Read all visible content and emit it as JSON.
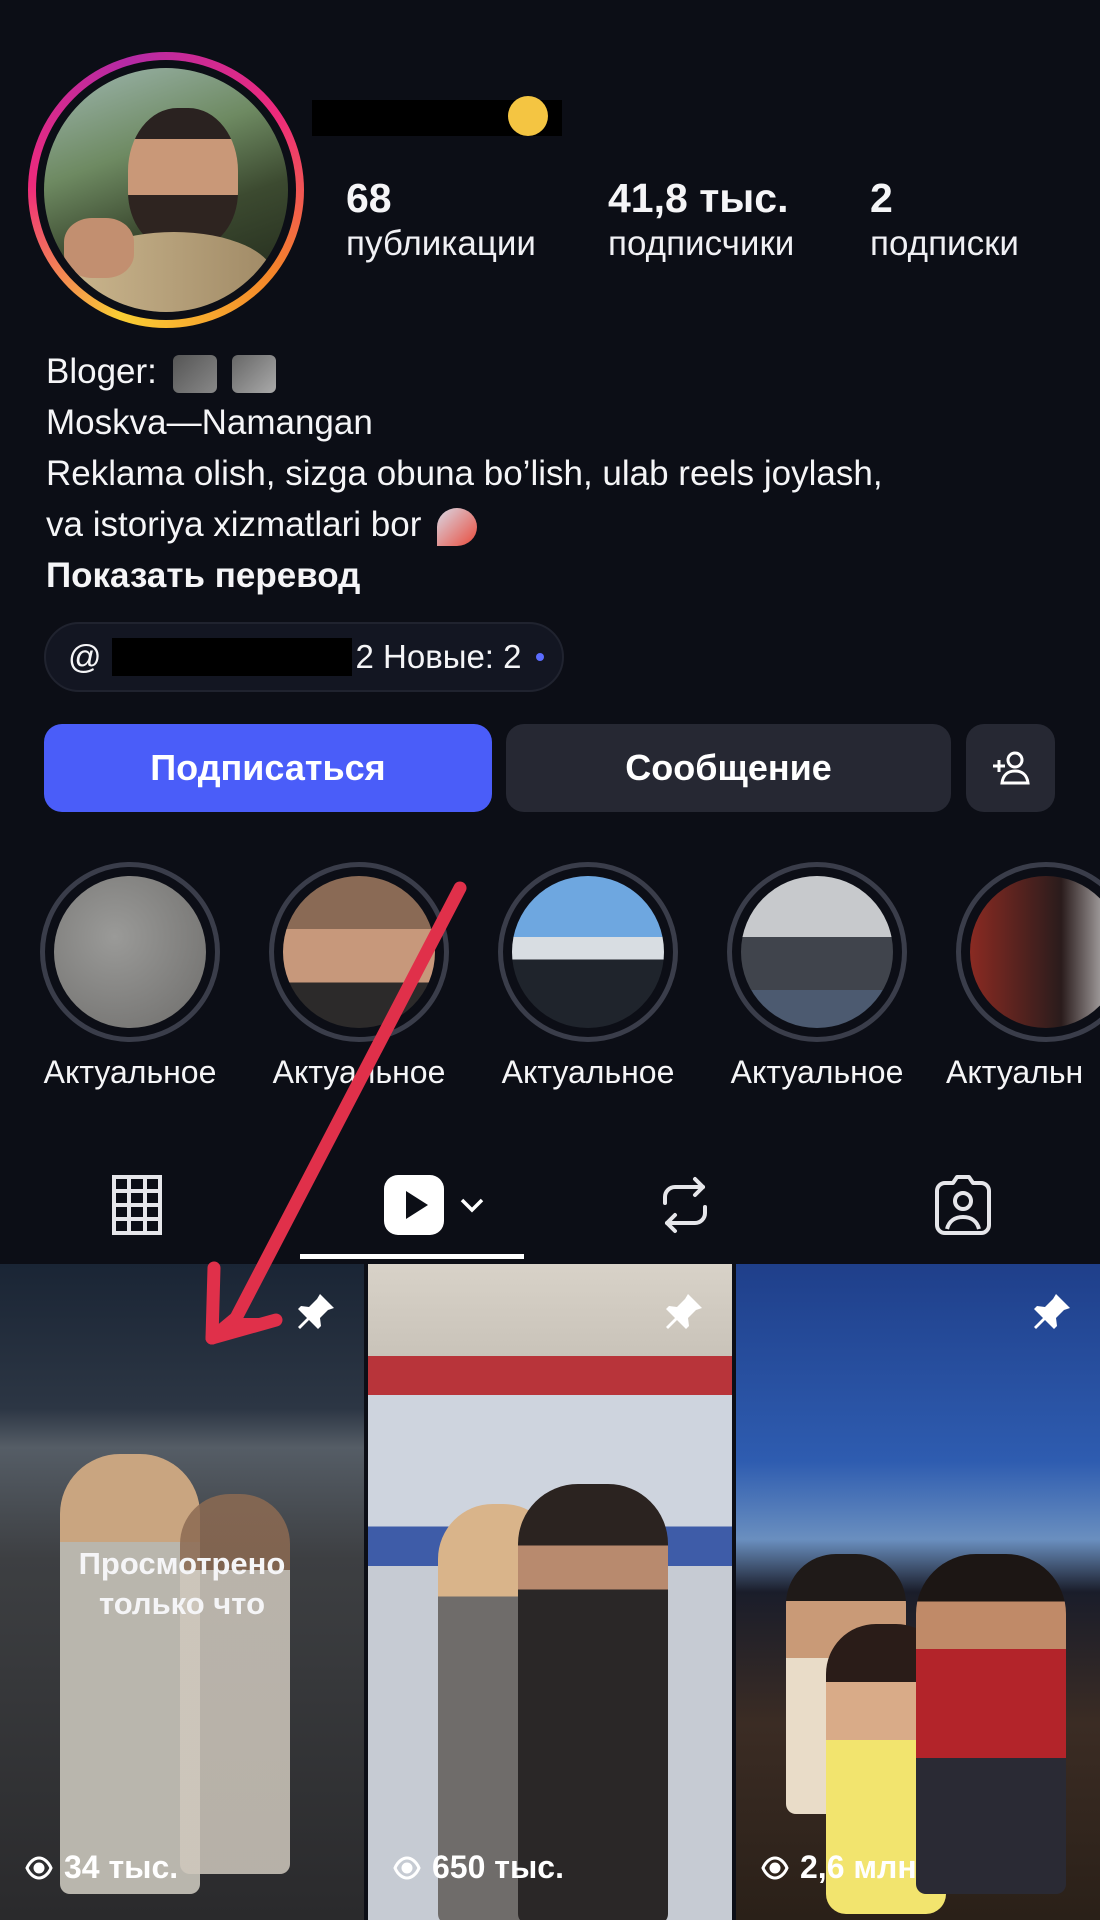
{
  "profile": {
    "stats": [
      {
        "value": "68",
        "label": "публикации"
      },
      {
        "value": "41,8 тыс.",
        "label": "подписчики"
      },
      {
        "value": "2",
        "label": "подписки"
      }
    ],
    "bio": {
      "line1": "Bloger:",
      "line2": "Moskva—Namangan",
      "line3": "Reklama olish, sizga obuna bo’lish, ulab reels joylash,",
      "line4": "va istoriya xizmatlari bor",
      "translate_link": "Показать перевод"
    },
    "threads": {
      "prefix": "@",
      "suffix": "2 Новые: 2"
    }
  },
  "actions": {
    "follow": "Подписаться",
    "message": "Сообщение"
  },
  "highlights": [
    {
      "label": "Актуальное"
    },
    {
      "label": "Актуальное"
    },
    {
      "label": "Актуальное"
    },
    {
      "label": "Актуальное"
    },
    {
      "label": "Актуальн"
    }
  ],
  "tabs": [
    "grid-icon",
    "reels-icon",
    "reposts-icon",
    "tagged-icon"
  ],
  "reels": [
    {
      "views": "34 тыс.",
      "overlay": "Просмотрено только что",
      "pinned": true
    },
    {
      "views": "650 тыс.",
      "pinned": true
    },
    {
      "views": "2,6 млн",
      "pinned": true
    }
  ],
  "colors": {
    "background": "#0c0e16",
    "follow_button": "#4a5df9",
    "secondary_button": "#262833",
    "annotation_arrow": "#e0304a"
  }
}
